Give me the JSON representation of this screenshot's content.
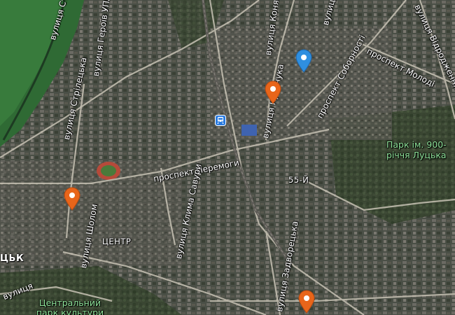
{
  "map": {
    "labels": {
      "vul_heroiv_upa": "вулиця Героїв УПА",
      "vul_koniakina": "вулиця Конякіна",
      "vul_top": "вулиця",
      "vul_vidrodzhennia": "вулиця Відродження",
      "prosp_molodi": "проспект Молоді",
      "prosp_sobornosti": "проспект Соборності",
      "vul_kravchuka": "вулиця Кравчука",
      "vul_striletska": "вулиця Стрілецька",
      "vul_stir": "вулиця Стир",
      "prosp_peremohy": "проспект Перемоги",
      "district_55": "55-Й",
      "park_900": "Парк ім. 900-річчя Луцька",
      "vul_klyma_savura": "вулиця Клима Савури",
      "vul_sholom": "вулиця Шолом",
      "tsentr": "ЦЕНТР",
      "lutsk_partial": "ЦЬК",
      "vul_zadvorets": "вулиця Задворецька",
      "vul_lutska": "вулиця",
      "central_park": "Центральний парк культури"
    },
    "pins": [
      {
        "name": "pin-kravchuka",
        "color": "#e8651a"
      },
      {
        "name": "pin-blue",
        "color": "#2f8fe0"
      },
      {
        "name": "pin-center-west",
        "color": "#e8651a"
      },
      {
        "name": "pin-south",
        "color": "#e8651a"
      }
    ],
    "metro_icon": "tram-station-icon"
  }
}
